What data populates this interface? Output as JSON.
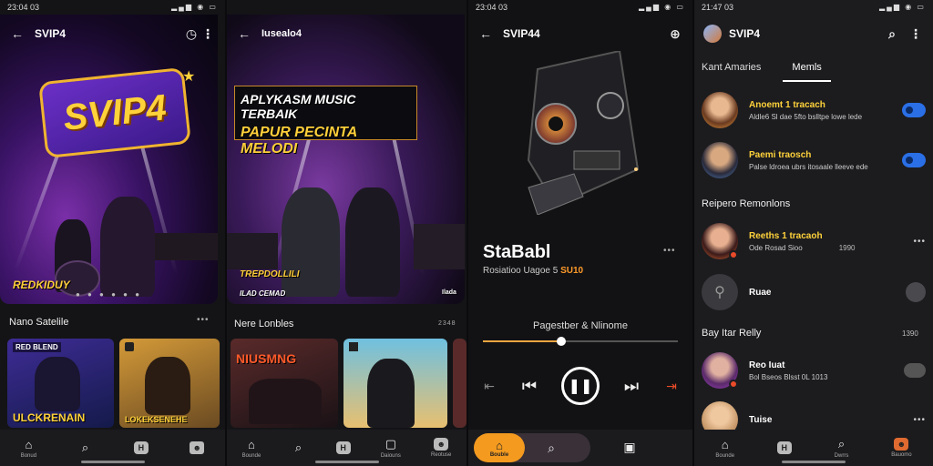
{
  "screens": {
    "s1": {
      "status_time": "23:04 03",
      "title": "SVIP4",
      "hero_logo": "SVIP4",
      "hero_caption": "REDKIDUY",
      "section": "Nano Satelile",
      "cards": [
        {
          "tag": "RED BLEND",
          "caption": "ULCKRENAIN"
        },
        {
          "tag": "",
          "caption": "LOKEKSENEHE"
        }
      ],
      "nav": [
        "Bonud",
        "",
        "",
        ""
      ]
    },
    "s2": {
      "title": "Iusealo4",
      "hero_line1": "APLYKASM MUSIC TERBAIK",
      "hero_line2": "PAPUR PECINTA MELODI",
      "hero_caption": "TREPDOLLILI",
      "hero_left_tag": "ILAD CEMAD",
      "hero_right_tag": "Ilada",
      "section": "Nere Lonbles",
      "section_meta": "2348",
      "cards": [
        {
          "caption": "NIUSMNG"
        },
        {
          "caption": ""
        }
      ],
      "nav": [
        "Bounde",
        "",
        "Daiouns",
        "Reotuse"
      ]
    },
    "s3": {
      "status_time": "23:04 03",
      "title": "SVIP44",
      "track_title": "StaBabl",
      "track_sub_prefix": "Rosiatioo Uagoe 5",
      "track_sub_highlight": "SU10",
      "album": "Pagestber & Nlinome",
      "progress": 0.4,
      "nav_home_label": "Bouble"
    },
    "s4": {
      "status_time": "21:47 03",
      "title": "SVIP4",
      "tabs": [
        "Kant Amaries",
        "Memls"
      ],
      "active_tab": 1,
      "rows_top": [
        {
          "title": "Anoemt 1 tracach",
          "sub": "Aldle6 Sl dae 5fto bslltpe lowe lede"
        },
        {
          "title": "Paemi traosch",
          "sub": "Palse ldroea ubrs itosaale lleeve ede"
        }
      ],
      "group1": "Reipero Remonlons",
      "rows_mid": [
        {
          "title": "Reeths 1 tracaoh",
          "sub": "Ode Rosad Sioo",
          "meta": "1990"
        },
        {
          "title": "Ruae",
          "sub": "",
          "meta": ""
        }
      ],
      "group2": "Bay Itar Relly",
      "group2_meta": "1390",
      "rows_bottom": [
        {
          "title": "Reo Iuat",
          "sub": "Bol Bseos Blsst 0L 1013"
        },
        {
          "title": "Tuise",
          "sub": ""
        }
      ],
      "nav": [
        "Bounde",
        "",
        "Dwrrs",
        "Bauomo"
      ]
    }
  },
  "colors": {
    "accent": "#f39a1f",
    "gold": "#ffd23a",
    "toggle": "#2a6fe6"
  }
}
